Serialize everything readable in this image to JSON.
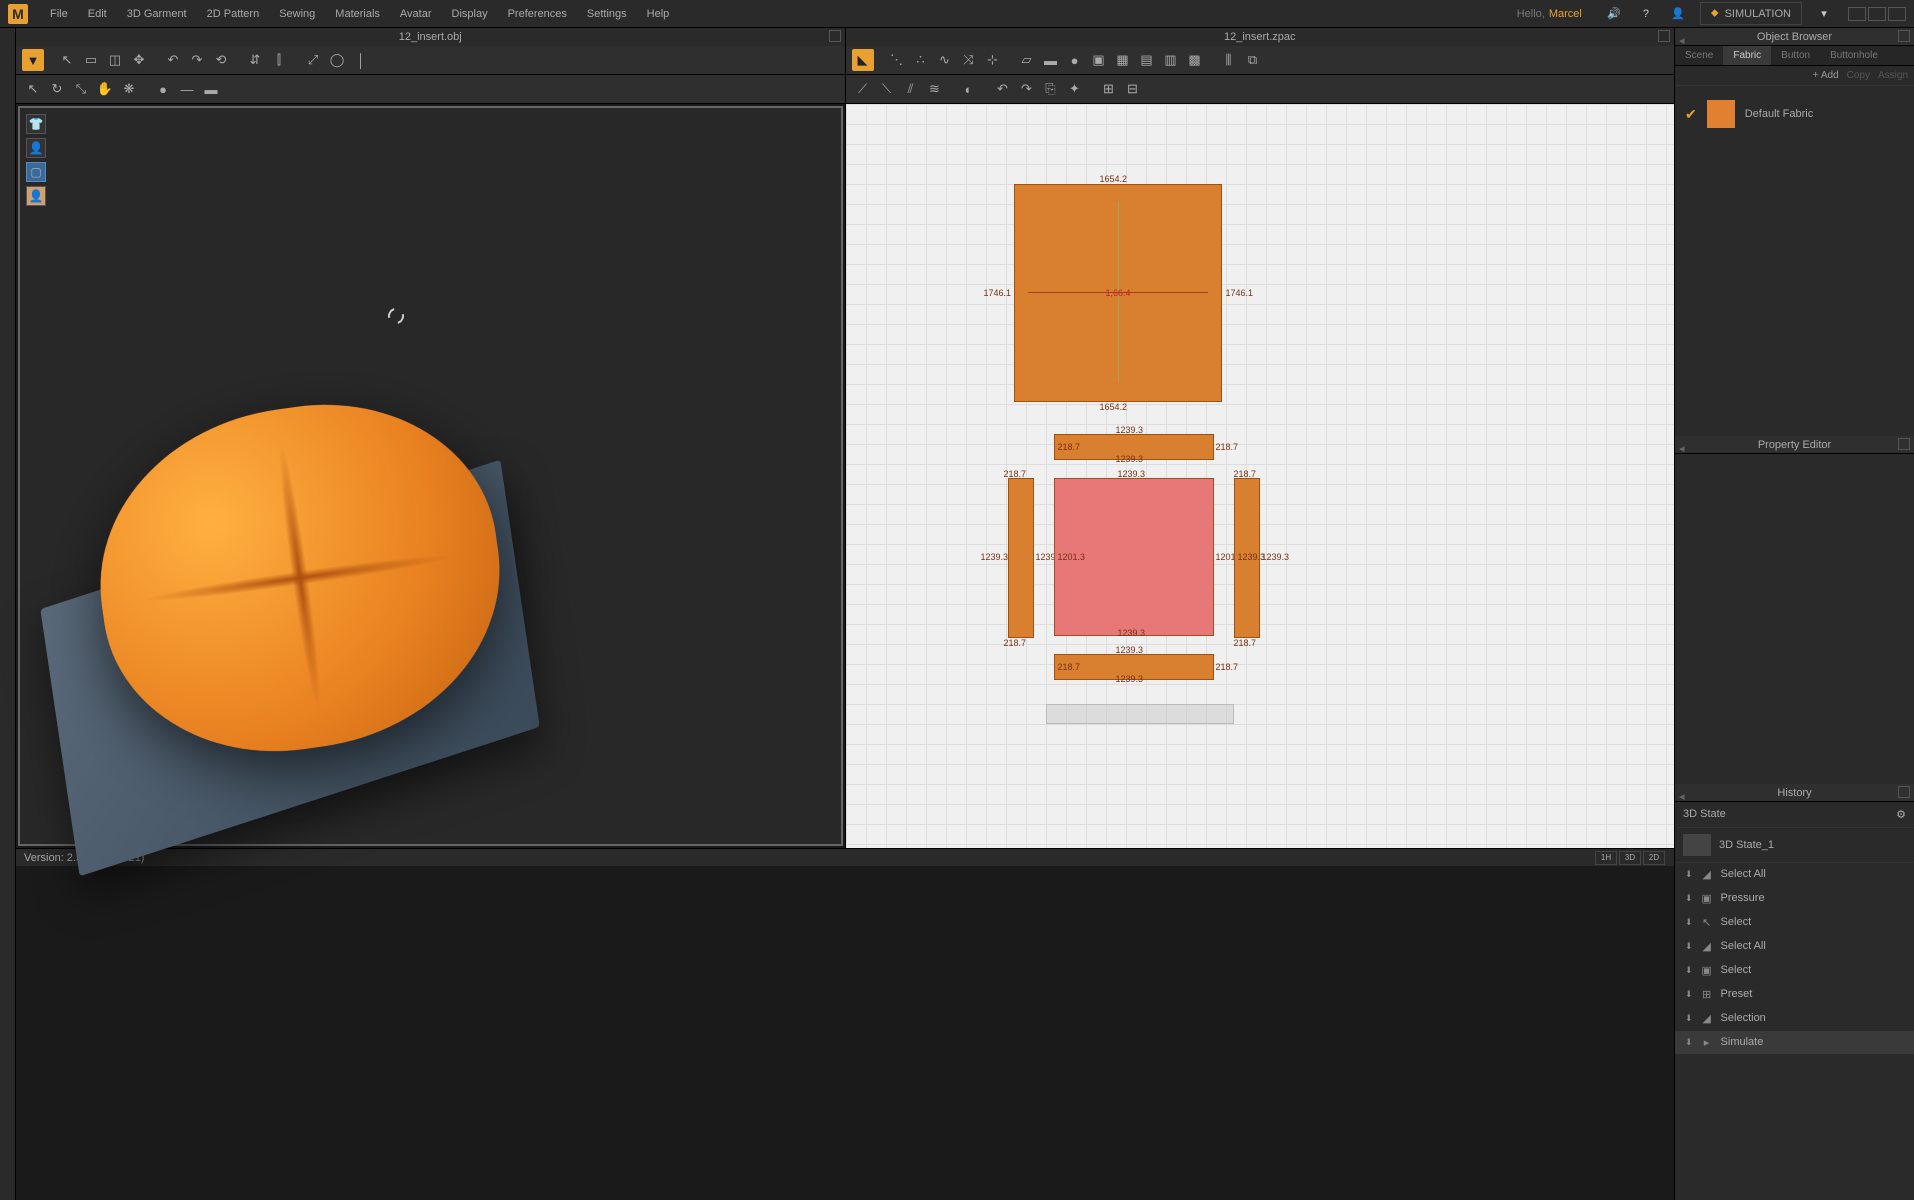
{
  "menu": {
    "items": [
      "File",
      "Edit",
      "3D Garment",
      "2D Pattern",
      "Sewing",
      "Materials",
      "Avatar",
      "Display",
      "Preferences",
      "Settings",
      "Help"
    ],
    "hello": "Hello,",
    "username": "Marcel",
    "simulation_label": "SIMULATION"
  },
  "views": {
    "view3d_title": "12_insert.obj",
    "view2d_title": "12_insert.zpac"
  },
  "pattern": {
    "top_square": {
      "top": "1654.2",
      "bottom": "1654.2",
      "left": "1746.1",
      "right": "1746.1",
      "center": "1,66.4"
    },
    "strip_h1": {
      "top": "1239.3",
      "bottom": "1239.3",
      "left": "218.7",
      "right": "218.7"
    },
    "strip_h2": {
      "top": "1239.3",
      "bottom": "1239.3",
      "left": "218.7",
      "right": "218.7"
    },
    "strip_vL": {
      "top": "218.7",
      "bottom": "218.7",
      "left": "1239.3",
      "right": "1239.3"
    },
    "strip_vR": {
      "top": "218.7",
      "bottom": "218.7",
      "left": "1239.3",
      "right": "1239.3"
    },
    "pink_square": {
      "top": "1239.3",
      "left": "1201.3",
      "right": "1201.3",
      "bottom": "1239.3"
    }
  },
  "object_browser": {
    "title": "Object Browser",
    "tabs": [
      "Scene",
      "Fabric",
      "Button",
      "Buttonhole"
    ],
    "active_tab": "Fabric",
    "add": "+ Add",
    "copy": "Copy",
    "assign": "Assign",
    "fabric_name": "Default Fabric"
  },
  "property_editor": {
    "title": "Property Editor"
  },
  "history": {
    "title": "History",
    "section": "3D State",
    "state_name": "3D State_1",
    "items": [
      "Select All",
      "Pressure",
      "Select",
      "Select All",
      "Select",
      "Preset",
      "Selection",
      "Simulate"
    ]
  },
  "status": {
    "version": "Version: 2.5.32   (123021)",
    "modes": [
      "1H",
      "3D",
      "2D"
    ]
  }
}
